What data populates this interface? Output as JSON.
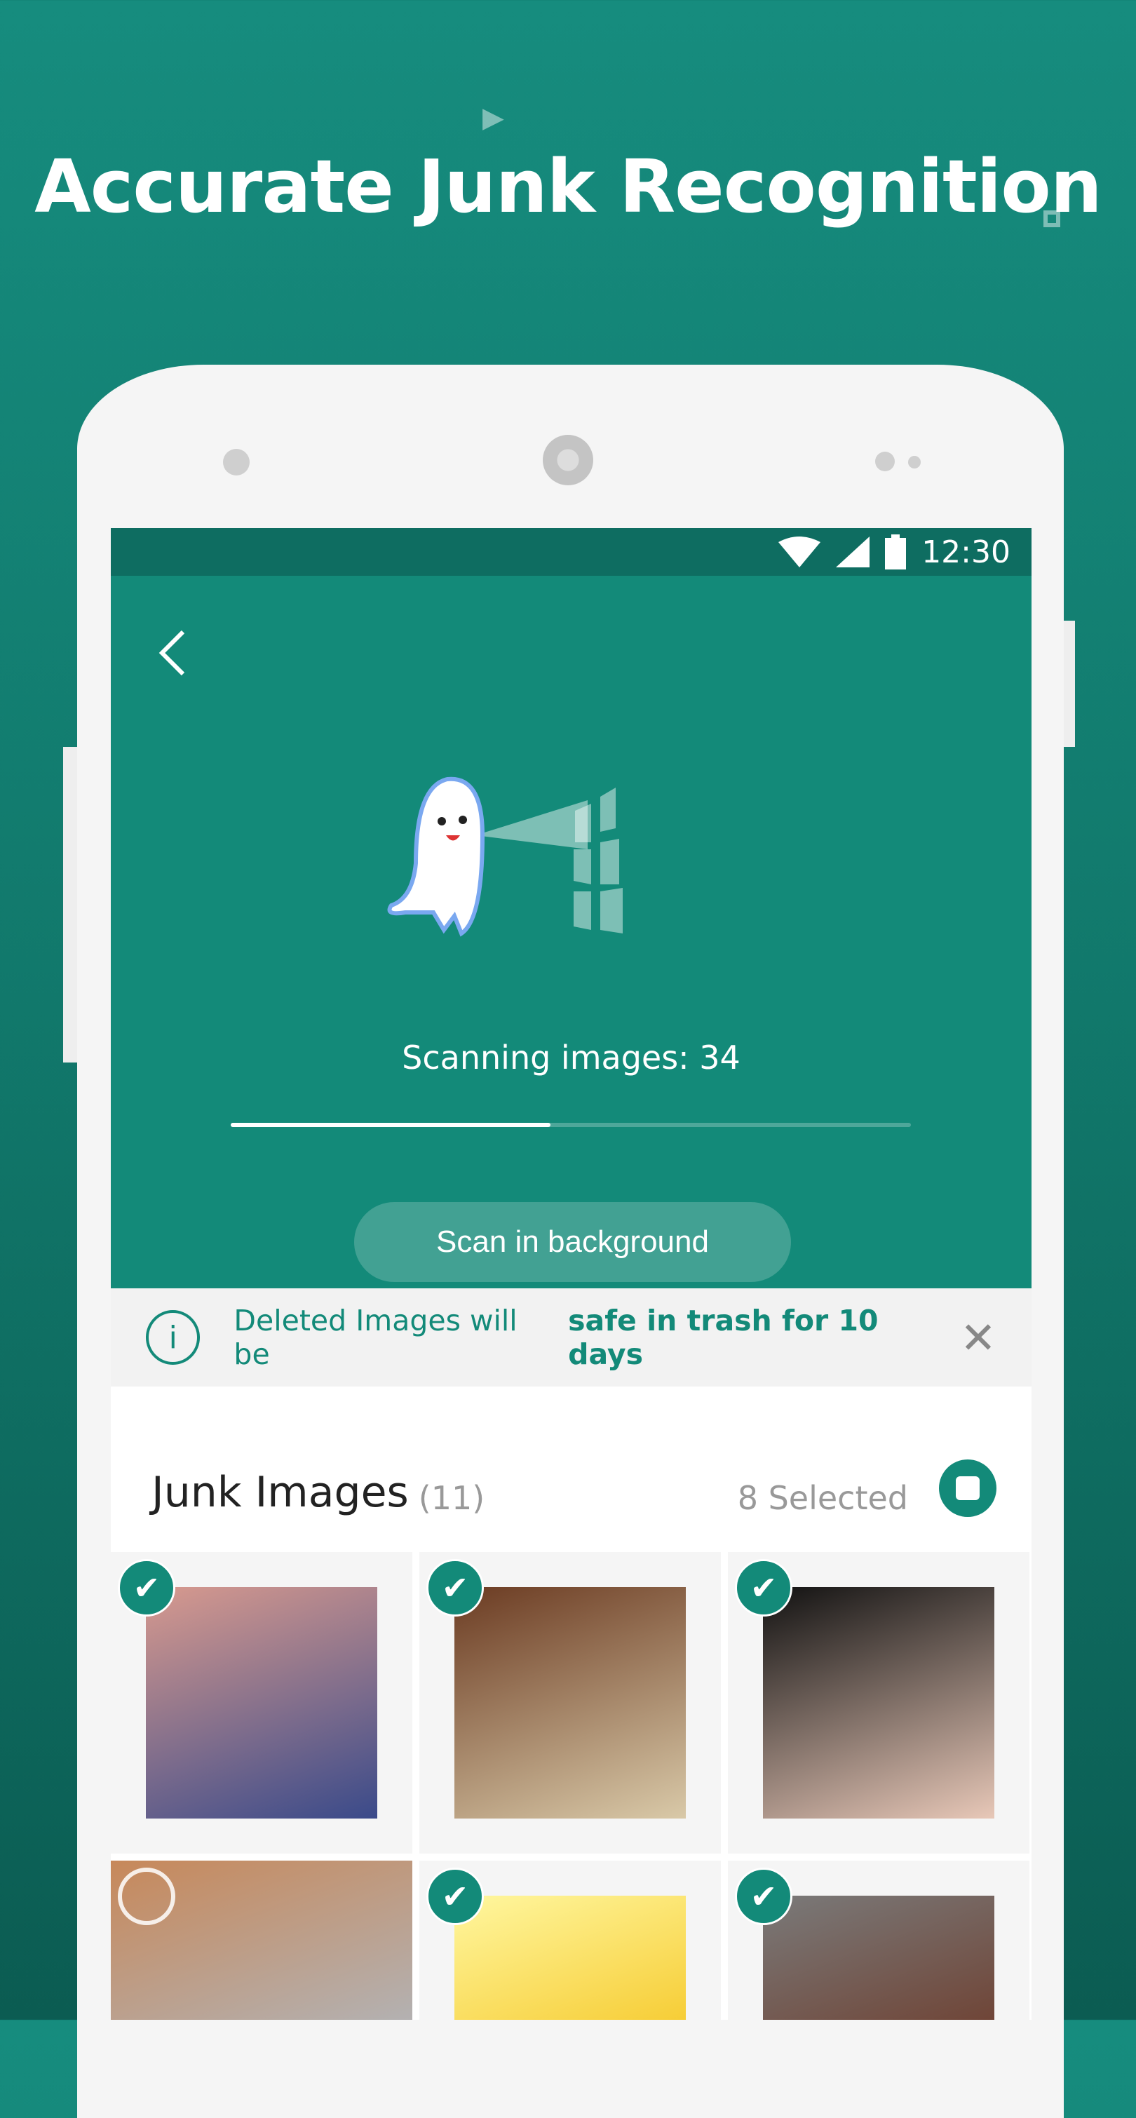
{
  "headline": "Accurate Junk Recognition",
  "status_bar": {
    "time": "12:30",
    "icons": [
      "wifi-icon",
      "signal-icon",
      "battery-icon"
    ]
  },
  "scan": {
    "label": "Scanning images: 34",
    "progress": 0.47,
    "background_button": "Scan in background"
  },
  "banner": {
    "text": "Deleted Images will be",
    "bold": "safe in trash for 10 days"
  },
  "junk": {
    "title": "Junk Images",
    "count": "(11)",
    "selected": "8 Selected"
  },
  "images": [
    {
      "name": "villa-seaside",
      "selected": true,
      "colors": [
        "#d89a8e",
        "#3a4a8a"
      ]
    },
    {
      "name": "good-morning-heart",
      "selected": true,
      "colors": [
        "#6b3b22",
        "#d9c9a8"
      ]
    },
    {
      "name": "sleeping-baby",
      "selected": true,
      "colors": [
        "#111111",
        "#e8c8b8"
      ]
    },
    {
      "name": "mac-finder-screenshot",
      "selected": false,
      "colors": [
        "#c7885a",
        "#a9c7e0"
      ]
    },
    {
      "name": "birds-sunrise",
      "selected": true,
      "colors": [
        "#fff7a0",
        "#f2b800"
      ]
    },
    {
      "name": "food-sculpture",
      "selected": true,
      "colors": [
        "#7a7a7a",
        "#6a2a15"
      ]
    }
  ],
  "colors": {
    "accent": "#138a79",
    "status": "#0e6d61"
  }
}
